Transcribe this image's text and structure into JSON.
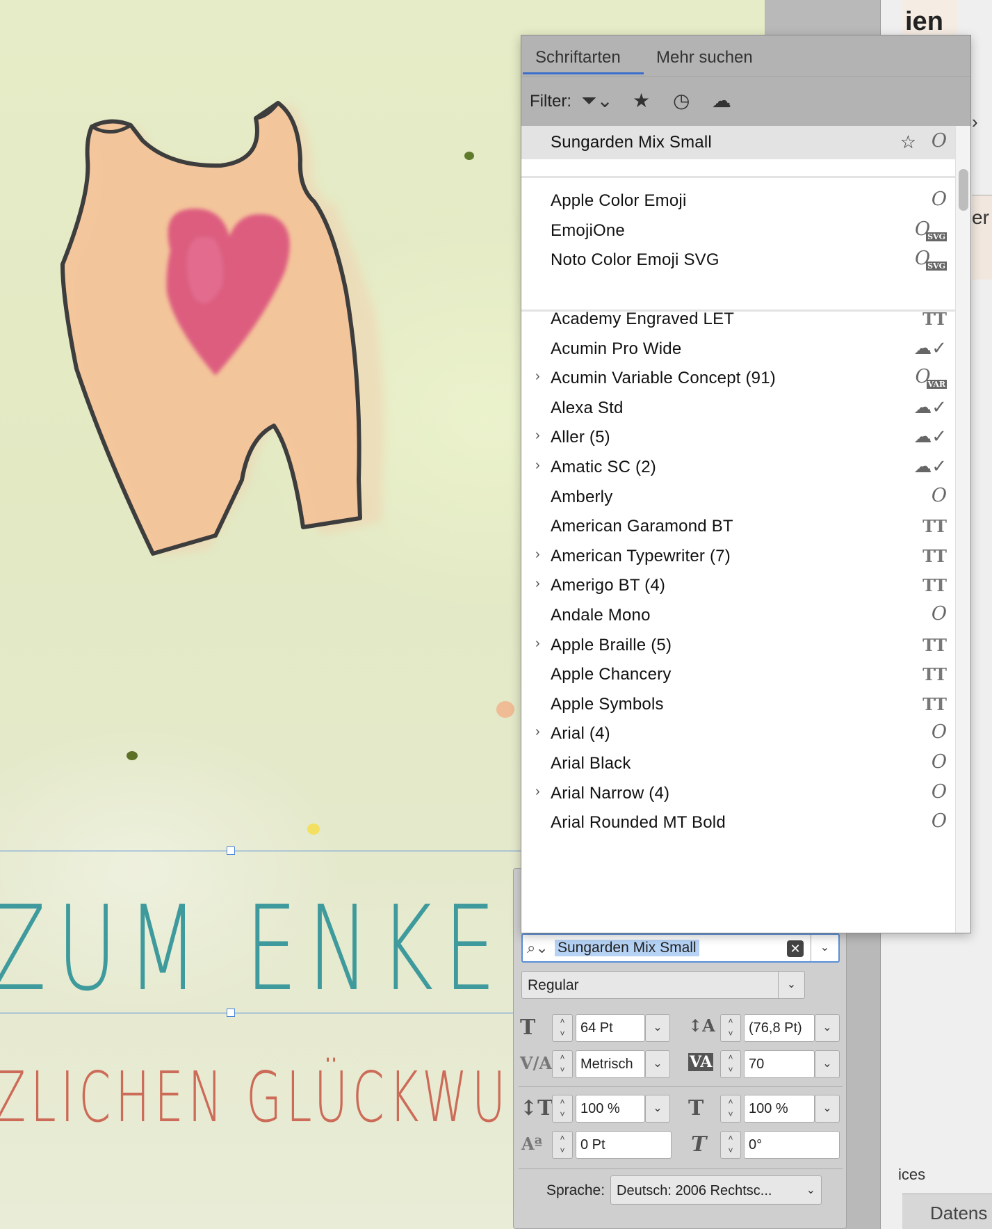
{
  "canvas": {
    "headline": "ZUM ENKEL",
    "subline": "ZLICHEN GLÜCKWUNS"
  },
  "right_panel": {
    "doc_title": "ien",
    "doc_mid_text": "er",
    "sidebar_label": "ices",
    "footer_label": "Datens"
  },
  "font_menu": {
    "tabs": [
      {
        "label": "Schriftarten",
        "active": true
      },
      {
        "label": "Mehr suchen",
        "active": false
      }
    ],
    "filter_label": "Filter:",
    "current_font": {
      "name": "Sungarden Mix Small",
      "icon": "opentype-icon"
    },
    "recent_fonts": [
      {
        "name": "Apple Color Emoji",
        "icon": "opentype-icon"
      },
      {
        "name": "EmojiOne",
        "icon": "opentype-svg-icon"
      },
      {
        "name": "Noto Color Emoji SVG",
        "icon": "opentype-svg-icon"
      }
    ],
    "fonts": [
      {
        "name": "Academy Engraved LET",
        "icon": "truetype-icon",
        "expandable": false
      },
      {
        "name": "Acumin Pro Wide",
        "icon": "cloud-activated-icon",
        "expandable": false
      },
      {
        "name": "Acumin Variable Concept (91)",
        "icon": "opentype-variable-icon",
        "expandable": true
      },
      {
        "name": "Alexa Std",
        "icon": "cloud-activated-icon",
        "expandable": false
      },
      {
        "name": "Aller (5)",
        "icon": "cloud-activated-icon",
        "expandable": true
      },
      {
        "name": "Amatic SC (2)",
        "icon": "cloud-activated-icon",
        "expandable": true
      },
      {
        "name": "Amberly",
        "icon": "opentype-icon",
        "expandable": false
      },
      {
        "name": "American Garamond BT",
        "icon": "truetype-icon",
        "expandable": false
      },
      {
        "name": "American Typewriter (7)",
        "icon": "truetype-icon",
        "expandable": true
      },
      {
        "name": "Amerigo BT (4)",
        "icon": "truetype-icon",
        "expandable": true
      },
      {
        "name": "Andale Mono",
        "icon": "opentype-icon",
        "expandable": false
      },
      {
        "name": "Apple Braille (5)",
        "icon": "truetype-icon",
        "expandable": true
      },
      {
        "name": "Apple Chancery",
        "icon": "truetype-icon",
        "expandable": false
      },
      {
        "name": "Apple Symbols",
        "icon": "truetype-icon",
        "expandable": false
      },
      {
        "name": "Arial (4)",
        "icon": "opentype-icon",
        "expandable": true
      },
      {
        "name": "Arial Black",
        "icon": "opentype-icon",
        "expandable": false
      },
      {
        "name": "Arial Narrow (4)",
        "icon": "opentype-icon",
        "expandable": true
      },
      {
        "name": "Arial Rounded MT Bold",
        "icon": "opentype-icon",
        "expandable": false
      }
    ],
    "icon_glyphs": {
      "opentype-icon": "O",
      "truetype-icon": "TT",
      "cloud-activated-icon": "☁✓",
      "svg_badge": "SVG",
      "var_badge": "VAR"
    }
  },
  "character_panel": {
    "font_search_value": "Sungarden Mix Small",
    "font_style": "Regular",
    "font_size": "64 Pt",
    "leading": "(76,8 Pt)",
    "kerning": "Metrisch",
    "tracking": "70",
    "vertical_scale": "100 %",
    "horizontal_scale": "100 %",
    "baseline_shift": "0 Pt",
    "skew": "0°",
    "language_label": "Sprache:",
    "language_value": "Deutsch: 2006 Rechtsc..."
  },
  "colors": {
    "headline": "#3e9a9c",
    "subline": "#cc6b58",
    "selection": "#4a86d8",
    "tab_underline": "#3b6dcc",
    "menu_header_bg": "#b3b3b3",
    "romper_fill": "#f4c298",
    "heart_fill": "#d94b7a"
  }
}
